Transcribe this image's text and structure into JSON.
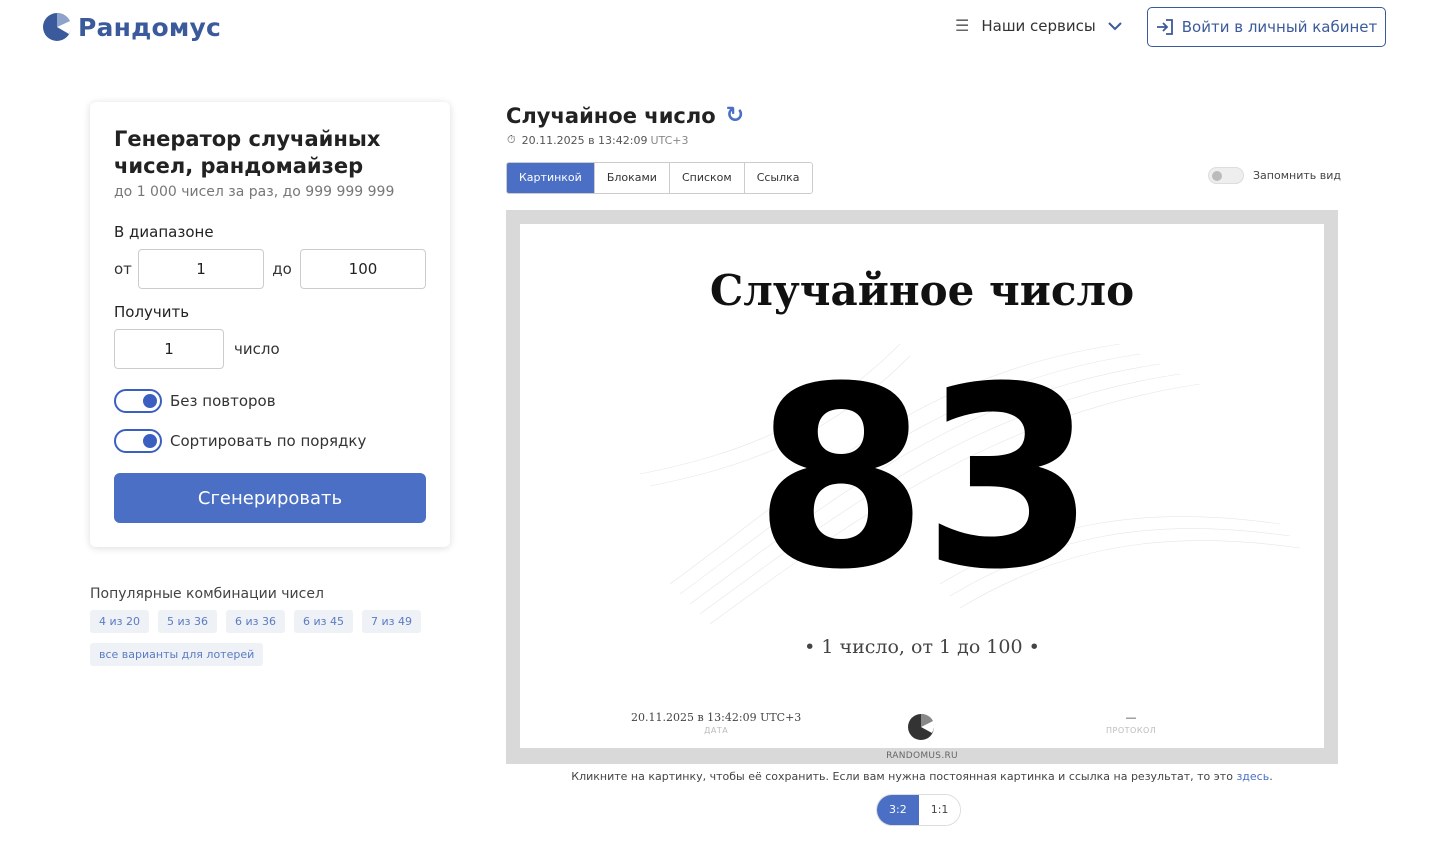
{
  "header": {
    "logo_text": "Рандомус",
    "services_label": "Наши сервисы",
    "login_label": "Войти в личный кабинет"
  },
  "form": {
    "title": "Генератор случайных чисел, рандомайзер",
    "subtitle": "до 1 000 чисел за раз, до 999 999 999",
    "range_label": "В диапазоне",
    "from_label": "от",
    "from_value": "1",
    "to_label": "до",
    "to_value": "100",
    "get_label": "Получить",
    "count_value": "1",
    "count_unit": "число",
    "no_repeat_label": "Без повторов",
    "no_repeat_on": true,
    "sort_label": "Сортировать по порядку",
    "sort_on": true,
    "generate_label": "Сгенерировать"
  },
  "popular": {
    "title": "Популярные комбинации чисел",
    "chips": [
      "4 из 20",
      "5 из 36",
      "6 из 36",
      "6 из 45",
      "7 из 49",
      "все варианты для лотерей"
    ]
  },
  "result": {
    "title": "Случайное число",
    "timestamp_main": "20.11.2025 в 13:42:09",
    "timestamp_tz": "UTC+3",
    "tabs": [
      "Картинкой",
      "Блоками",
      "Списком",
      "Ссылка"
    ],
    "active_tab": "Картинкой",
    "remember_label": "Запомнить вид",
    "image": {
      "title": "Случайное число",
      "number": "83",
      "description": "• 1 число, от 1 до 100 •",
      "date": "20.11.2025 в 13:42:09 UTC+3",
      "date_caption": "ДАТА",
      "protocol": "—",
      "protocol_caption": "ПРОТОКОЛ",
      "site": "RANDOMUS.RU"
    },
    "hint": "Кликните на картинку, чтобы её сохранить. Если вам нужна постоянная картинка и ссылка на результат, то это",
    "hint_link": "здесь",
    "ratios": [
      "3:2",
      "1:1"
    ],
    "active_ratio": "3:2"
  },
  "colors": {
    "brand": "#3b5a9b",
    "accent": "#4a6fc4"
  }
}
